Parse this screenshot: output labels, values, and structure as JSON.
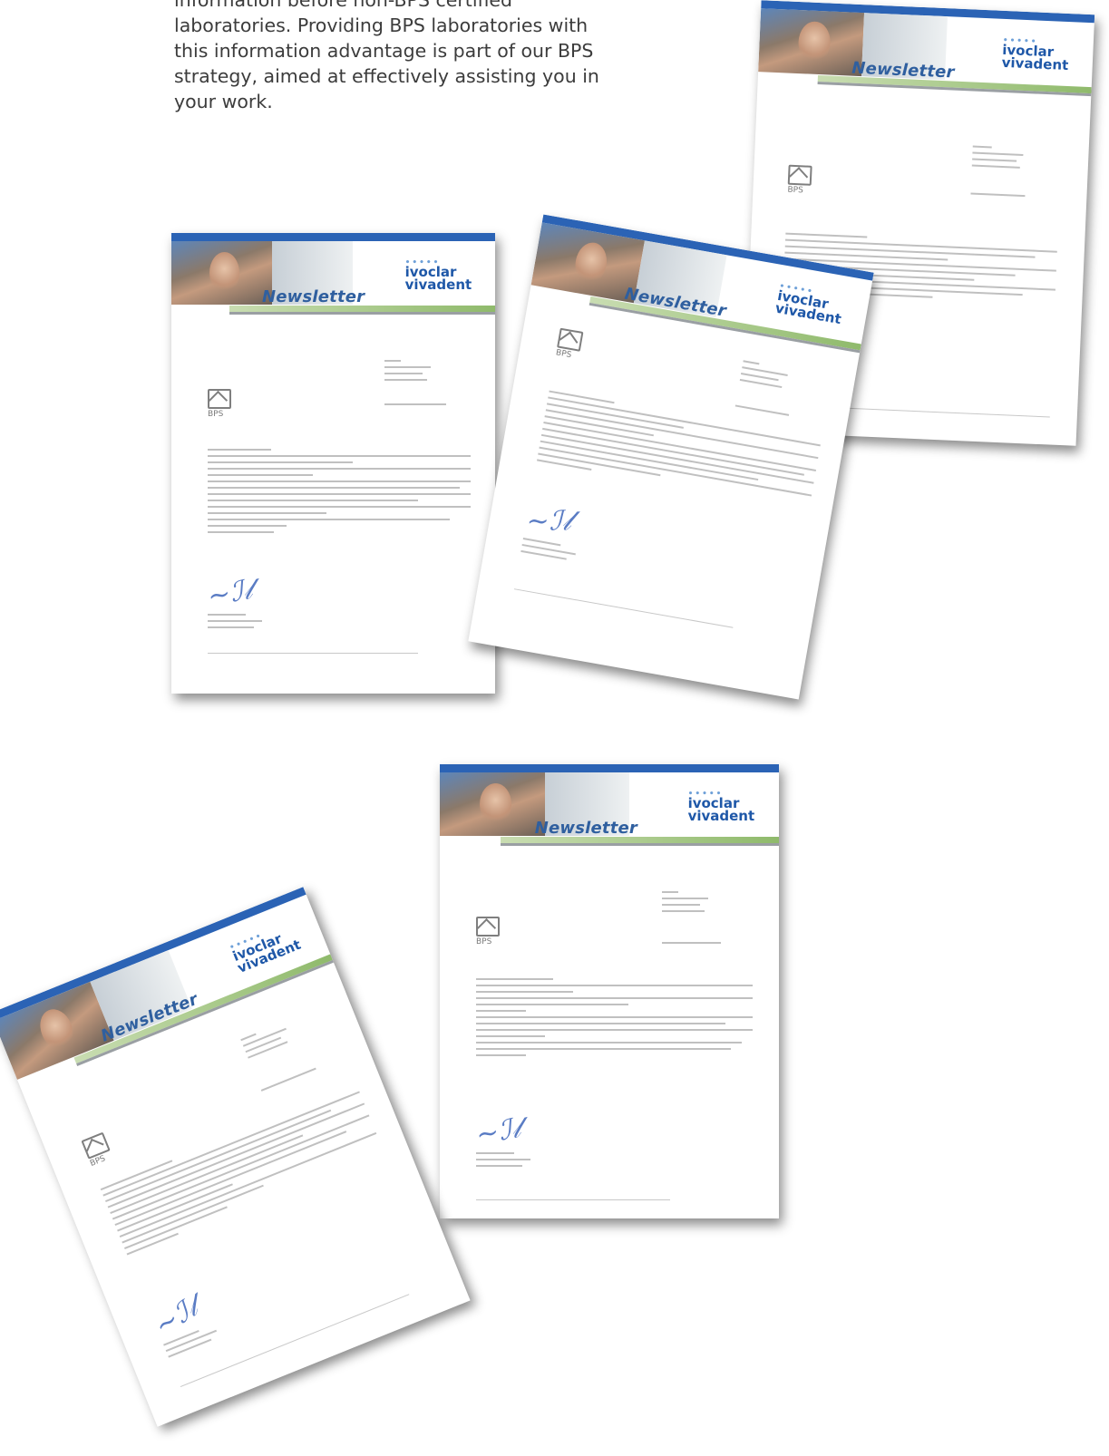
{
  "intro": {
    "lines": [
      "information before non-BPS certified",
      "laboratories. Providing BPS laboratories with",
      "this information advantage is part of our BPS",
      "strategy, aimed at effectively assisting you in",
      "your work."
    ]
  },
  "letter": {
    "newsletter_title": "Newsletter",
    "brand_line1": "ivoclar",
    "brand_line2": "vivadent",
    "bps_mark": "BPS"
  },
  "colors": {
    "band_blue": "#2b63b5",
    "title_blue": "#2f5f9f",
    "signature_blue": "#5a7cc4"
  }
}
